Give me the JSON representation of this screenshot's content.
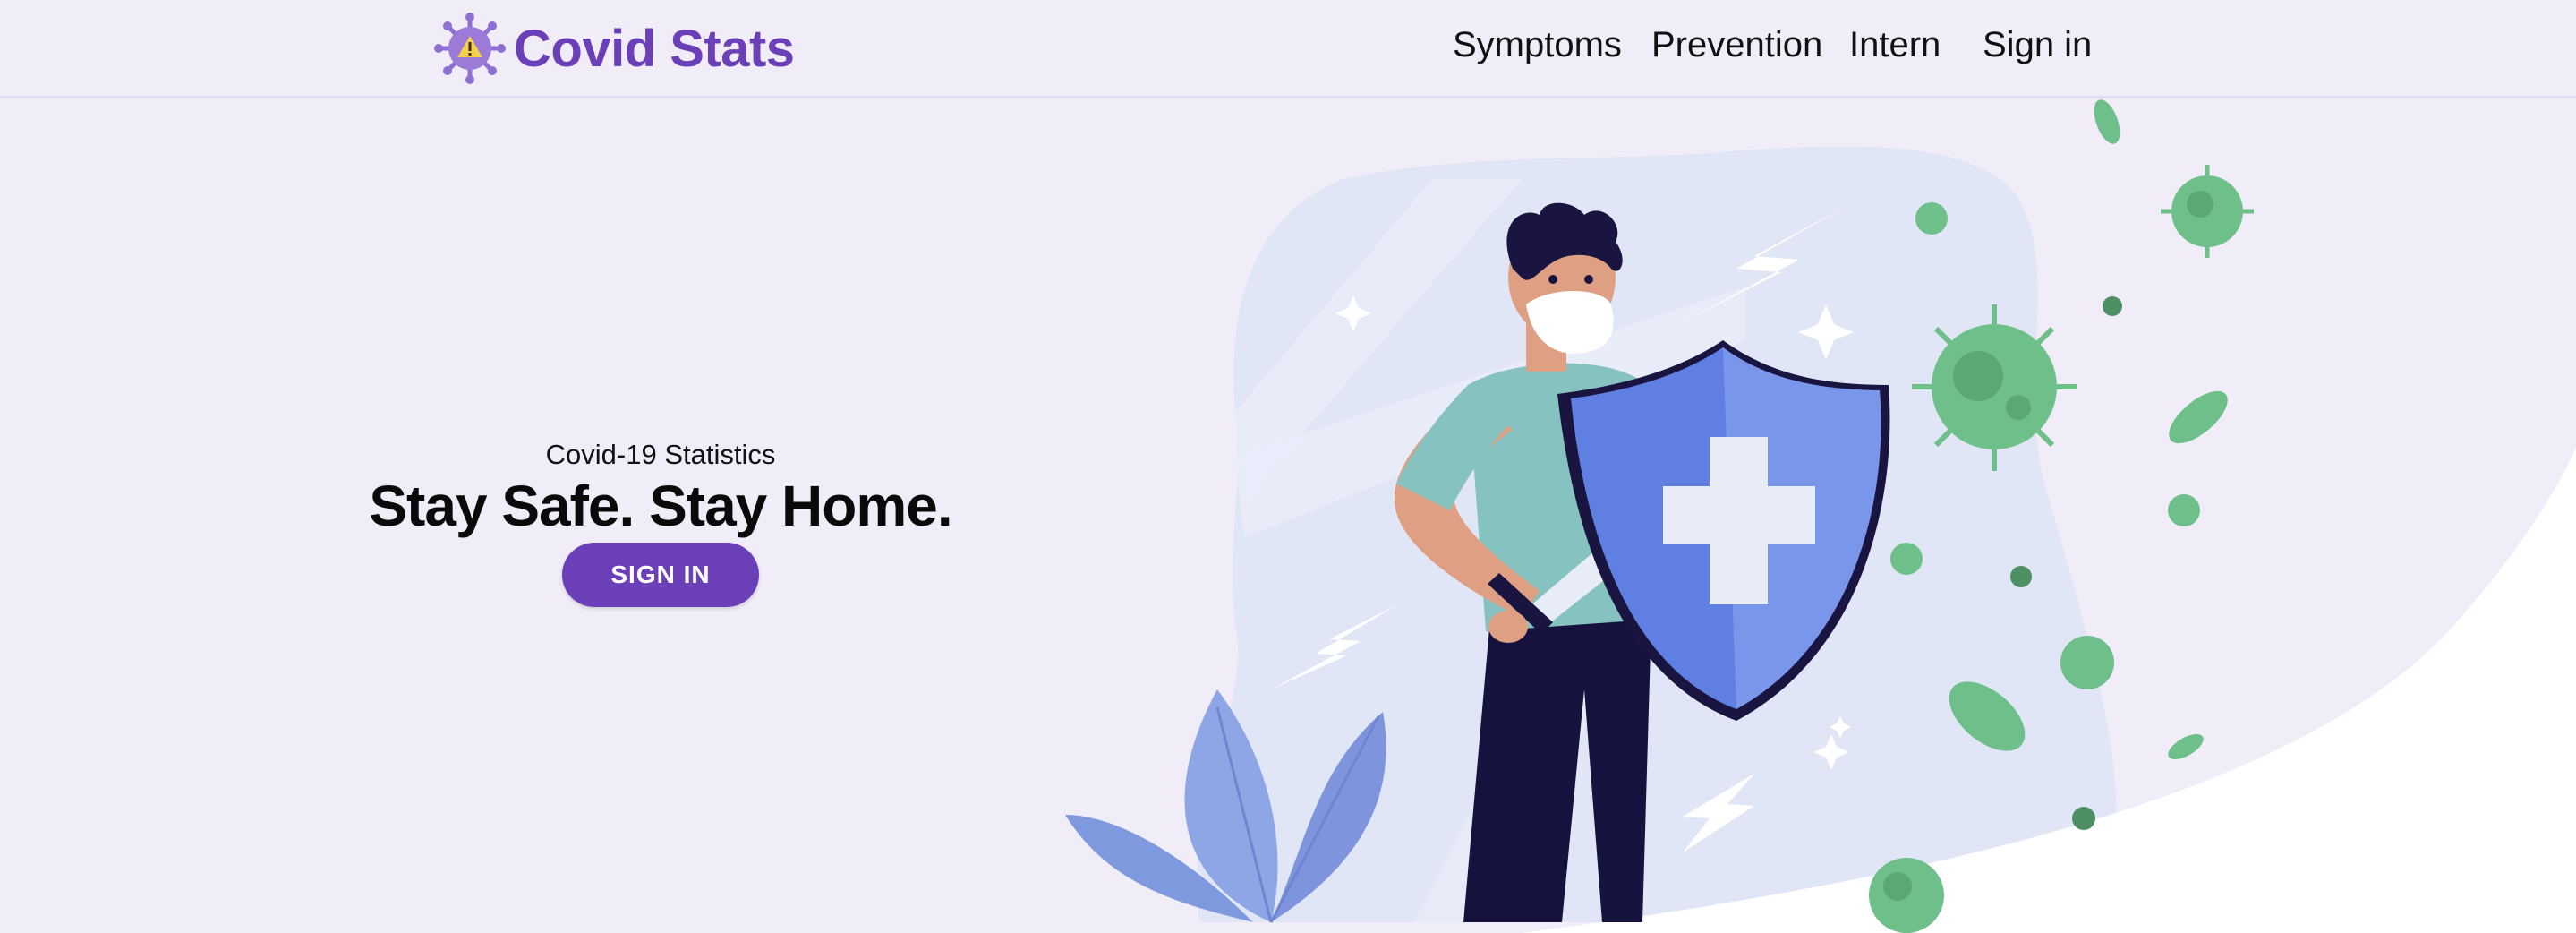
{
  "navbar": {
    "brand": "Covid Stats",
    "links": {
      "symptoms": "Symptoms",
      "prevention": "Prevention",
      "intern": "Intern",
      "signin": "Sign in"
    }
  },
  "hero": {
    "subtitle": "Covid-19 Statistics",
    "title": "Stay Safe. Stay Home.",
    "button": "SIGN IN"
  },
  "colors": {
    "background": "#f1edf8",
    "brand": "#6b3fb8",
    "virus": "#6fbf8a",
    "shield": "#6a8ce8"
  },
  "icons": {
    "logo": "virus-warning-icon"
  }
}
